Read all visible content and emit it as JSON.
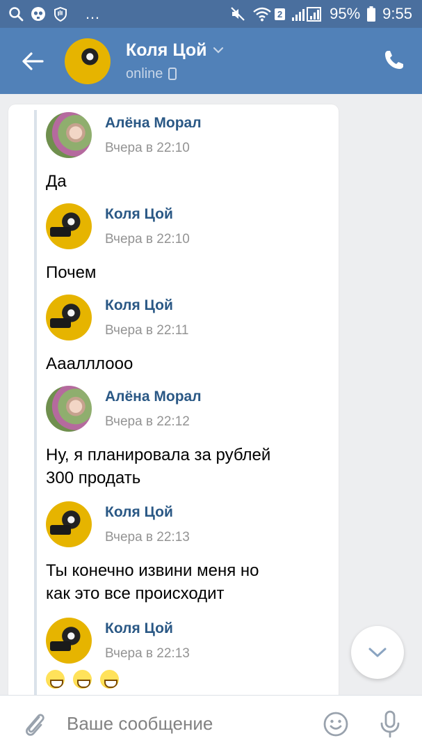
{
  "status_bar": {
    "sim_badge": "2",
    "battery": "95%",
    "time": "9:55",
    "more": "…"
  },
  "header": {
    "name": "Коля Цой",
    "status": "online"
  },
  "messages": [
    {
      "author": "Алёна Морал",
      "time": "Вчера в 22:10",
      "text": "Да"
    },
    {
      "author": "Коля Цой",
      "time": "Вчера в 22:10",
      "text": "Почем"
    },
    {
      "author": "Коля Цой",
      "time": "Вчера в 22:11",
      "text": "Ааалллооо"
    },
    {
      "author": "Алёна Морал",
      "time": "Вчера в 22:12",
      "text_line1": "Ну, я планировала за рублей",
      "text_line2": "300 продать"
    },
    {
      "author": "Коля Цой",
      "time": "Вчера в 22:13",
      "text_line1": "Ты конечно извини меня но",
      "text_line2": "как это все происходит"
    },
    {
      "author": "Коля Цой",
      "time": "Вчера в 22:13",
      "emoji": [
        "grinning-face-emoji",
        "grinning-face-emoji",
        "grinning-face-emoji"
      ]
    }
  ],
  "composer": {
    "placeholder": "Ваше сообщение"
  },
  "colors": {
    "header": "#5181b8",
    "status_bar": "#4a6f9e",
    "author_name": "#2a5885",
    "timestamp": "#939393"
  }
}
